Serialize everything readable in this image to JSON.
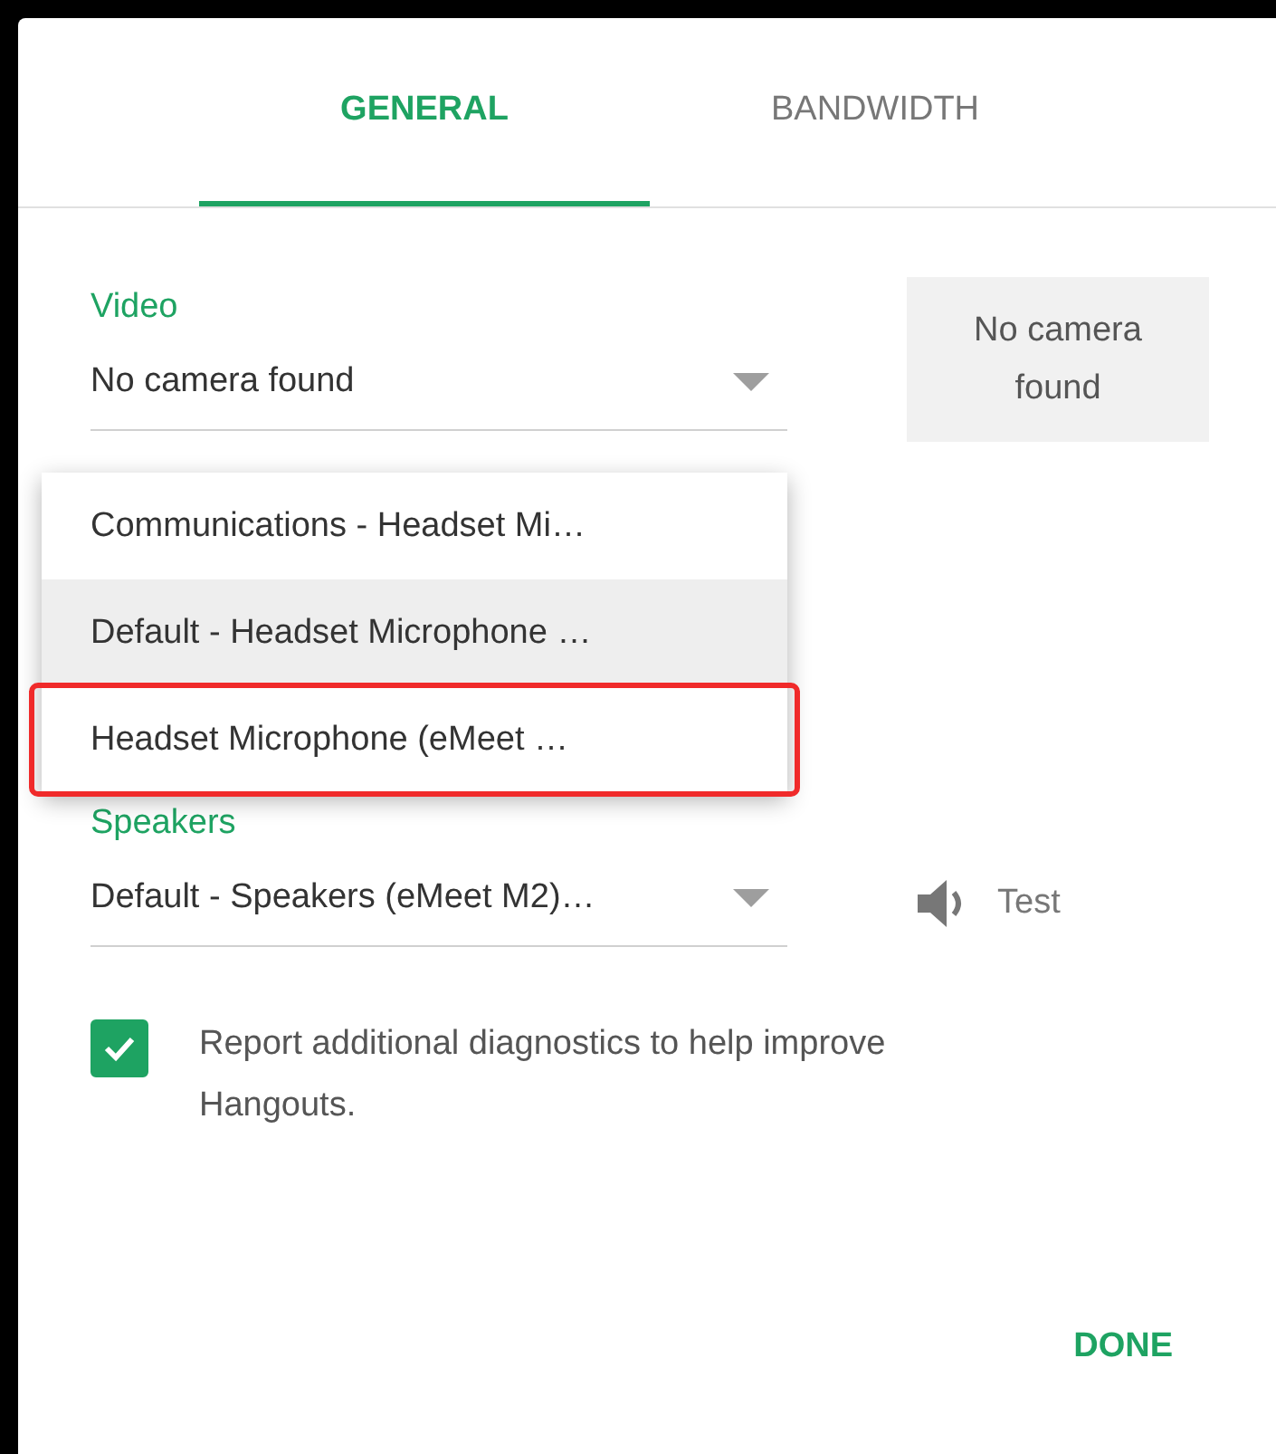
{
  "tabs": [
    {
      "label": "GENERAL",
      "selected": true
    },
    {
      "label": "BANDWIDTH",
      "selected": false
    }
  ],
  "video": {
    "label": "Video",
    "value": "No camera found",
    "preview": "No camera found"
  },
  "microphone_menu": [
    {
      "label": "Communications - Headset Mi…",
      "selected": false,
      "outlined": false
    },
    {
      "label": "Default - Headset Microphone …",
      "selected": true,
      "outlined": false
    },
    {
      "label": "Headset Microphone (eMeet …",
      "selected": false,
      "outlined": true
    }
  ],
  "speakers": {
    "label": "Speakers",
    "value": "Default - Speakers (eMeet M2)…",
    "test": "Test"
  },
  "diagnostics": {
    "checked": true,
    "label": "Report additional diagnostics to help improve Hangouts."
  },
  "done": "DONE"
}
